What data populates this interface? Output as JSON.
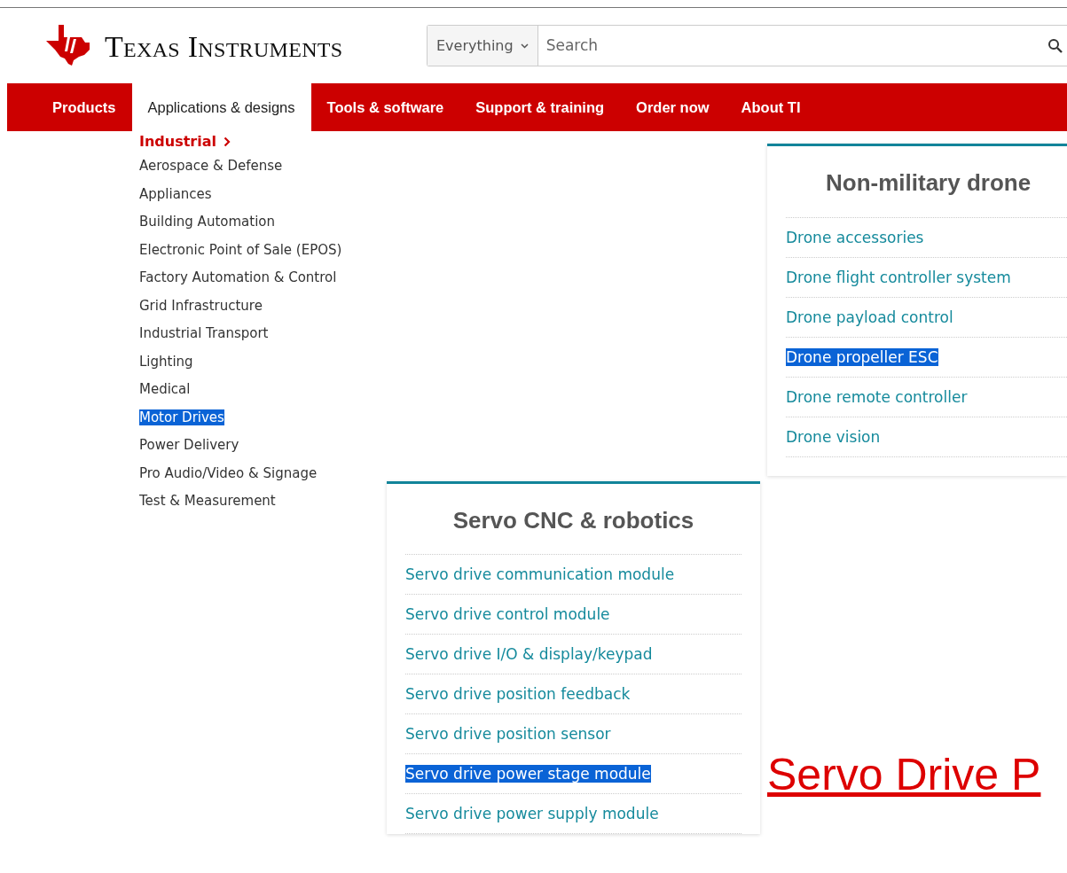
{
  "header": {
    "logo_text": "Texas Instruments",
    "search_scope": "Everything",
    "search_placeholder": "Search"
  },
  "nav": [
    {
      "label": "Products",
      "selected": false
    },
    {
      "label": "Applications & designs",
      "selected": true
    },
    {
      "label": "Tools & software",
      "selected": false
    },
    {
      "label": "Support & training",
      "selected": false
    },
    {
      "label": "Order now",
      "selected": false
    },
    {
      "label": "About TI",
      "selected": false
    }
  ],
  "sidebar": {
    "active": "Industrial",
    "items": [
      {
        "label": "Aerospace & Defense",
        "highlighted": false
      },
      {
        "label": "Appliances",
        "highlighted": false
      },
      {
        "label": "Building Automation",
        "highlighted": false
      },
      {
        "label": "Electronic Point of Sale (EPOS)",
        "highlighted": false
      },
      {
        "label": "Factory Automation & Control",
        "highlighted": false
      },
      {
        "label": "Grid Infrastructure",
        "highlighted": false
      },
      {
        "label": "Industrial Transport",
        "highlighted": false
      },
      {
        "label": "Lighting",
        "highlighted": false
      },
      {
        "label": "Medical",
        "highlighted": false
      },
      {
        "label": "Motor Drives",
        "highlighted": true
      },
      {
        "label": "Power Delivery",
        "highlighted": false
      },
      {
        "label": "Pro Audio/Video & Signage",
        "highlighted": false
      },
      {
        "label": "Test & Measurement",
        "highlighted": false
      }
    ]
  },
  "servo_panel": {
    "title": "Servo CNC & robotics",
    "links": [
      {
        "label": "Servo drive communication module",
        "highlighted": false
      },
      {
        "label": "Servo drive control module",
        "highlighted": false
      },
      {
        "label": "Servo drive I/O & display/keypad",
        "highlighted": false
      },
      {
        "label": "Servo drive position feedback",
        "highlighted": false
      },
      {
        "label": "Servo drive position sensor",
        "highlighted": false
      },
      {
        "label": "Servo drive power stage module",
        "highlighted": true
      },
      {
        "label": "Servo drive power supply module",
        "highlighted": false
      }
    ]
  },
  "drone_panel": {
    "title": "Non-military drone",
    "links": [
      {
        "label": "Drone accessories",
        "highlighted": false
      },
      {
        "label": "Drone flight controller system",
        "highlighted": false
      },
      {
        "label": "Drone payload control",
        "highlighted": false
      },
      {
        "label": "Drone propeller ESC",
        "highlighted": true
      },
      {
        "label": "Drone remote controller",
        "highlighted": false
      },
      {
        "label": "Drone vision",
        "highlighted": false
      }
    ]
  },
  "annotation": "Servo Drive P"
}
